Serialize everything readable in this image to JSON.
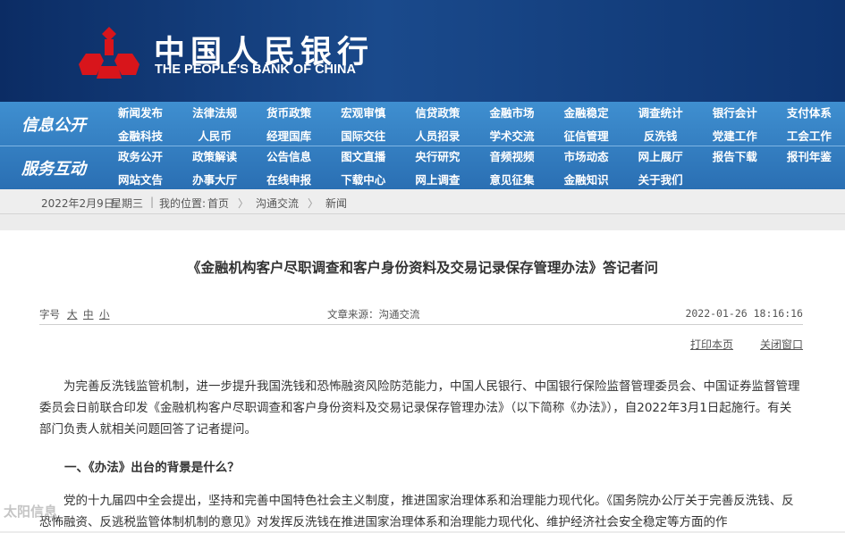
{
  "header": {
    "cn_title": "中国人民银行",
    "en_title": "THE PEOPLE'S BANK OF CHINA"
  },
  "nav": {
    "cat1": "信息公开",
    "cat2": "服务互动",
    "row1": [
      "新闻发布",
      "法律法规",
      "货币政策",
      "宏观审慎",
      "信贷政策",
      "金融市场",
      "金融稳定",
      "调查统计",
      "银行会计",
      "支付体系"
    ],
    "row2": [
      "金融科技",
      "人民币",
      "经理国库",
      "国际交往",
      "人员招录",
      "学术交流",
      "征信管理",
      "反洗钱",
      "党建工作",
      "工会工作"
    ],
    "row3": [
      "政务公开",
      "政策解读",
      "公告信息",
      "图文直播",
      "央行研究",
      "音频视频",
      "市场动态",
      "网上展厅",
      "报告下载",
      "报刊年鉴"
    ],
    "row4": [
      "网站文告",
      "办事大厅",
      "在线申报",
      "下载中心",
      "网上调查",
      "意见征集",
      "金融知识",
      "关于我们"
    ]
  },
  "breadcrumb": {
    "date": "2022年2月9日",
    "weekday": "星期三",
    "location_label": "我的位置:",
    "home": "首页",
    "section": "沟通交流",
    "sub": "新闻"
  },
  "article": {
    "title": "《金融机构客户尽职调查和客户身份资料及交易记录保存管理办法》答记者问",
    "font_label": "字号",
    "font_large": "大",
    "font_medium": "中",
    "font_small": "小",
    "source": "文章来源：沟通交流",
    "datetime": "2022-01-26 18:16:16",
    "print": "打印本页",
    "close": "关闭窗口",
    "para1": "为完善反洗钱监管机制，进一步提升我国洗钱和恐怖融资风险防范能力，中国人民银行、中国银行保险监督管理委员会、中国证券监督管理委员会日前联合印发《金融机构客户尽职调查和客户身份资料及交易记录保存管理办法》（以下简称《办法》），自2022年3月1日起施行。有关部门负责人就相关问题回答了记者提问。",
    "heading1": "一、《办法》出台的背景是什么？",
    "para2": "党的十九届四中全会提出，坚持和完善中国特色社会主义制度，推进国家治理体系和治理能力现代化。《国务院办公厅关于完善反洗钱、反恐怖融资、反逃税监管体制机制的意见》对发挥反洗钱在推进国家治理体系和治理能力现代化、维护经济社会安全稳定等方面的作"
  },
  "watermark": "太阳信息"
}
